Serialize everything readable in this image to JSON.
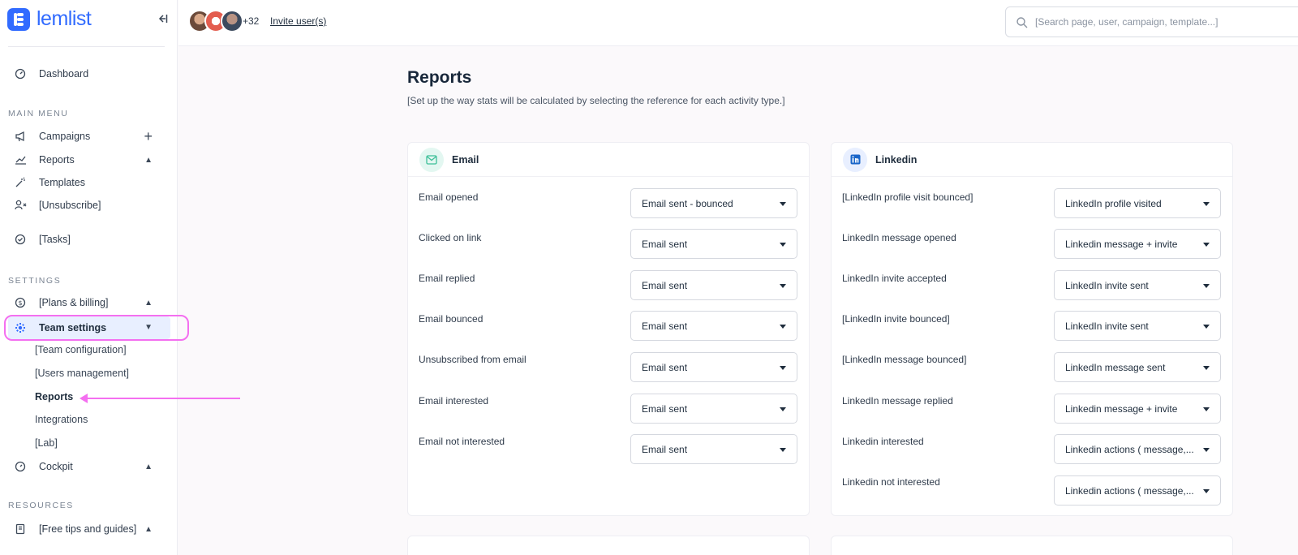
{
  "app": {
    "brand": "lemlist"
  },
  "sidebar": {
    "dashboard": "Dashboard",
    "main_menu_label": "MAIN MENU",
    "campaigns": "Campaigns",
    "reports": "Reports",
    "templates": "Templates",
    "unsubscribe": "[Unsubscribe]",
    "tasks": "[Tasks]",
    "settings_label": "SETTINGS",
    "plans_billing": "[Plans & billing]",
    "team_settings": "Team settings",
    "team_sub": {
      "team_configuration": "[Team configuration]",
      "users_management": "[Users management]",
      "reports": "Reports",
      "integrations": "Integrations",
      "lab": "[Lab]"
    },
    "cockpit": "Cockpit",
    "resources_label": "RESOURCES",
    "free_tips": "[Free tips and guides]"
  },
  "topbar": {
    "more_users": "+32",
    "invite_label": "Invite user(s)",
    "search_placeholder": "[Search page, user, campaign, template...]"
  },
  "main": {
    "title": "Reports",
    "subtitle": "[Set up the way stats will be calculated by selecting the reference for each activity type.]"
  },
  "email_card": {
    "title": "Email",
    "rows": [
      {
        "label": "Email opened",
        "value": "Email sent - bounced"
      },
      {
        "label": "Clicked on link",
        "value": "Email sent"
      },
      {
        "label": "Email replied",
        "value": "Email sent"
      },
      {
        "label": "Email bounced",
        "value": "Email sent"
      },
      {
        "label": "Unsubscribed from email",
        "value": "Email sent"
      },
      {
        "label": "Email interested",
        "value": "Email sent"
      },
      {
        "label": "Email not interested",
        "value": "Email sent"
      }
    ]
  },
  "linkedin_card": {
    "title": "Linkedin",
    "rows": [
      {
        "label": "[LinkedIn profile visit bounced]",
        "value": "LinkedIn profile visited"
      },
      {
        "label": "LinkedIn message opened",
        "value": "Linkedin message + invite"
      },
      {
        "label": "LinkedIn invite accepted",
        "value": "LinkedIn invite sent"
      },
      {
        "label": "[LinkedIn invite bounced]",
        "value": "LinkedIn invite sent"
      },
      {
        "label": "[LinkedIn message bounced]",
        "value": "LinkedIn message sent"
      },
      {
        "label": "LinkedIn message replied",
        "value": "Linkedin message + invite"
      },
      {
        "label": "Linkedin interested",
        "value": "Linkedin actions ( message,..."
      },
      {
        "label": "Linkedin not interested",
        "value": "Linkedin actions ( message,..."
      }
    ]
  },
  "colors": {
    "brand": "#316bff",
    "highlight": "#f46ff0",
    "email_badge": "#e3f7f1",
    "linkedin_badge": "#e8efff"
  },
  "icons": {
    "logo": "lemlist-logo",
    "collapse": "collapse-sidebar-icon",
    "search": "search-icon",
    "email": "envelope-icon",
    "linkedin": "linkedin-icon"
  }
}
